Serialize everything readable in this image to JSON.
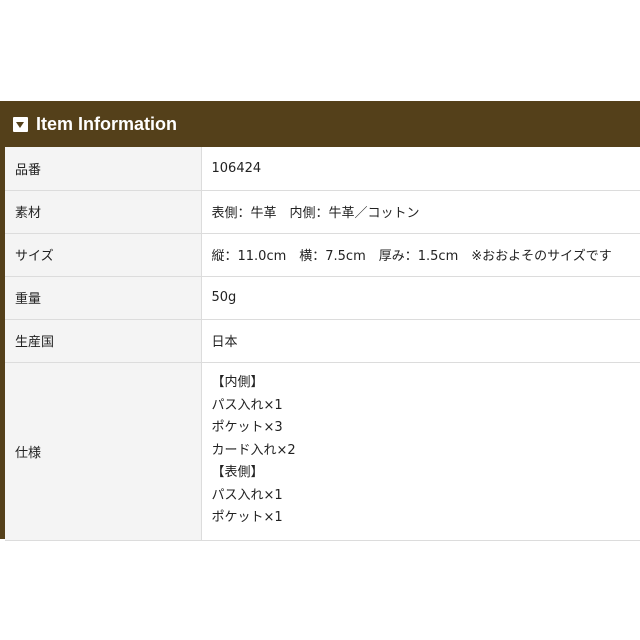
{
  "header": {
    "title": "Item Information",
    "icon": "dropdown-toggle-icon",
    "bg_color": "#54401a"
  },
  "rows": [
    {
      "label": "品番",
      "value": "106424"
    },
    {
      "label": "素材",
      "value": "表側：牛革　内側：牛革／コットン"
    },
    {
      "label": "サイズ",
      "value": "縦：11.0cm　横：7.5cm　厚み：1.5cm　※おおよそのサイズです"
    },
    {
      "label": "重量",
      "value": "50g"
    },
    {
      "label": "生産国",
      "value": "日本"
    }
  ],
  "spec": {
    "label": "仕様",
    "lines": [
      "【内側】",
      "パス入れ×1",
      "ポケット×3",
      "カード入れ×2",
      "【表側】",
      "パス入れ×1",
      "ポケット×1"
    ]
  }
}
